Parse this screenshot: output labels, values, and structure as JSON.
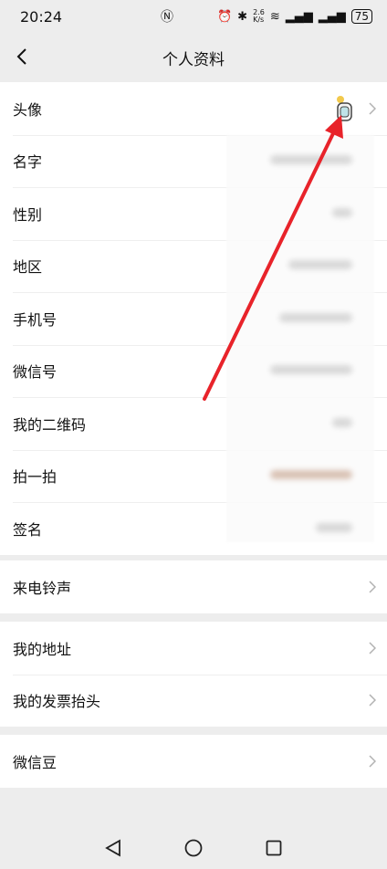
{
  "status_bar": {
    "time": "20:24",
    "net_speed": "2.6\nK/s",
    "battery": "75"
  },
  "nav": {
    "title": "个人资料"
  },
  "profile_rows": [
    {
      "label": "头像"
    },
    {
      "label": "名字"
    },
    {
      "label": "性别"
    },
    {
      "label": "地区"
    },
    {
      "label": "手机号"
    },
    {
      "label": "微信号"
    },
    {
      "label": "我的二维码"
    },
    {
      "label": "拍一拍"
    },
    {
      "label": "签名"
    }
  ],
  "ringtone_row": {
    "label": "来电铃声"
  },
  "address_rows": [
    {
      "label": "我的地址"
    },
    {
      "label": "我的发票抬头"
    }
  ],
  "beans_row": {
    "label": "微信豆"
  },
  "colors": {
    "background": "#ededed",
    "annotation_arrow": "#e8232a"
  }
}
